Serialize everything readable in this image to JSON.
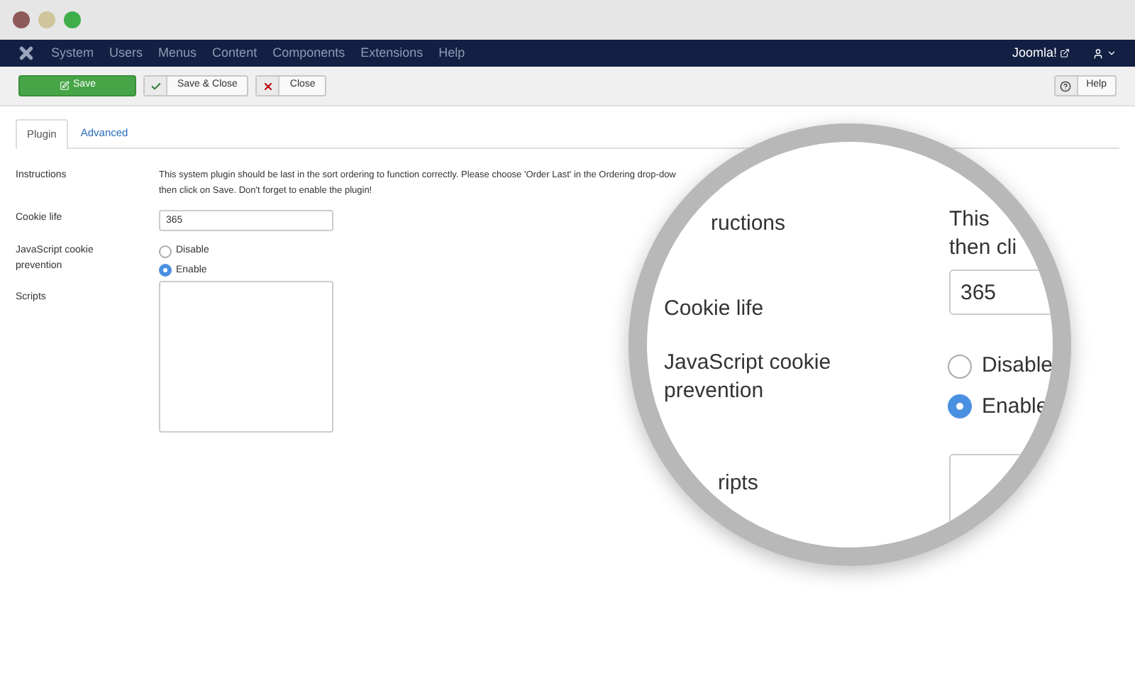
{
  "menu": [
    "System",
    "Users",
    "Menus",
    "Content",
    "Components",
    "Extensions",
    "Help"
  ],
  "site_link": "Joomla!",
  "toolbar": [
    {
      "kind": "save",
      "label": "Save"
    },
    {
      "kind": "save_close",
      "label": "Save & Close"
    },
    {
      "kind": "close",
      "label": "Close"
    }
  ],
  "help_button": "Help",
  "tabs": [
    {
      "label": "Plugin",
      "selected": true
    },
    {
      "label": "Advanced",
      "selected": false
    }
  ],
  "fields": [
    {
      "kind": "note",
      "label": "Instructions",
      "lines": [
        "This system plugin should be last in the sort ordering to function correctly. Please choose 'Order Last' in the Ordering drop-dow",
        "then click on Save. Don't forget to enable the plugin!"
      ]
    },
    {
      "kind": "text",
      "label": "Cookie life",
      "value": "365"
    },
    {
      "kind": "radio",
      "label": "JavaScript cookie prevention",
      "options": [
        {
          "label": "Disable",
          "selected": false
        },
        {
          "label": "Enable",
          "selected": true
        }
      ]
    },
    {
      "kind": "textarea",
      "label": "Scripts"
    }
  ],
  "magnifier": {
    "instructions_label": "ructions",
    "instructions_lines": [
      "This",
      "then cli"
    ],
    "cookie_label": "Cookie life",
    "cookie_value": "365",
    "js_label": "JavaScript cookie prevention",
    "options": [
      {
        "label": "Disable",
        "selected": false
      },
      {
        "label": "Enable",
        "selected": true
      }
    ],
    "scripts_label": "ripts"
  }
}
